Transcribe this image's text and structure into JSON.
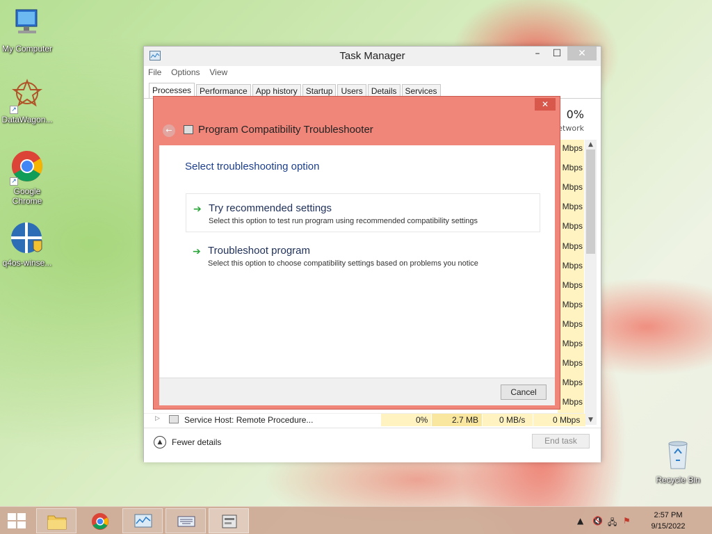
{
  "desktop": {
    "icons": [
      {
        "label": "My Computer"
      },
      {
        "label": "DataWagon..."
      },
      {
        "label": "Google Chrome"
      },
      {
        "label": "q4os-winse..."
      },
      {
        "label": "Recycle Bin"
      }
    ]
  },
  "task_manager": {
    "title": "Task Manager",
    "menu": [
      "File",
      "Options",
      "View"
    ],
    "tabs": [
      "Processes",
      "Performance",
      "App history",
      "Startup",
      "Users",
      "Details",
      "Services"
    ],
    "active_tab": "Processes",
    "network_column": {
      "percent": "0%",
      "label": "Network"
    },
    "network_cells": [
      "Mbps",
      "Mbps",
      "Mbps",
      "Mbps",
      "Mbps",
      "Mbps",
      "Mbps",
      "Mbps",
      "Mbps",
      "Mbps",
      "Mbps",
      "Mbps",
      "Mbps",
      "Mbps"
    ],
    "last_row": {
      "name": "Service Host: Remote Procedure...",
      "cpu": "0%",
      "memory": "2.7 MB",
      "disk": "0 MB/s",
      "network": "0 Mbps"
    },
    "fewer_details": "Fewer details",
    "end_task": "End task"
  },
  "troubleshooter": {
    "title": "Program Compatibility Troubleshooter",
    "heading": "Select troubleshooting option",
    "options": [
      {
        "title": "Try recommended settings",
        "desc": "Select this option to test run program using recommended compatibility settings"
      },
      {
        "title": "Troubleshoot program",
        "desc": "Select this option to choose compatibility settings based on problems you notice"
      }
    ],
    "cancel": "Cancel"
  },
  "taskbar": {
    "clock_time": "2:57 PM",
    "clock_date": "9/15/2022"
  }
}
